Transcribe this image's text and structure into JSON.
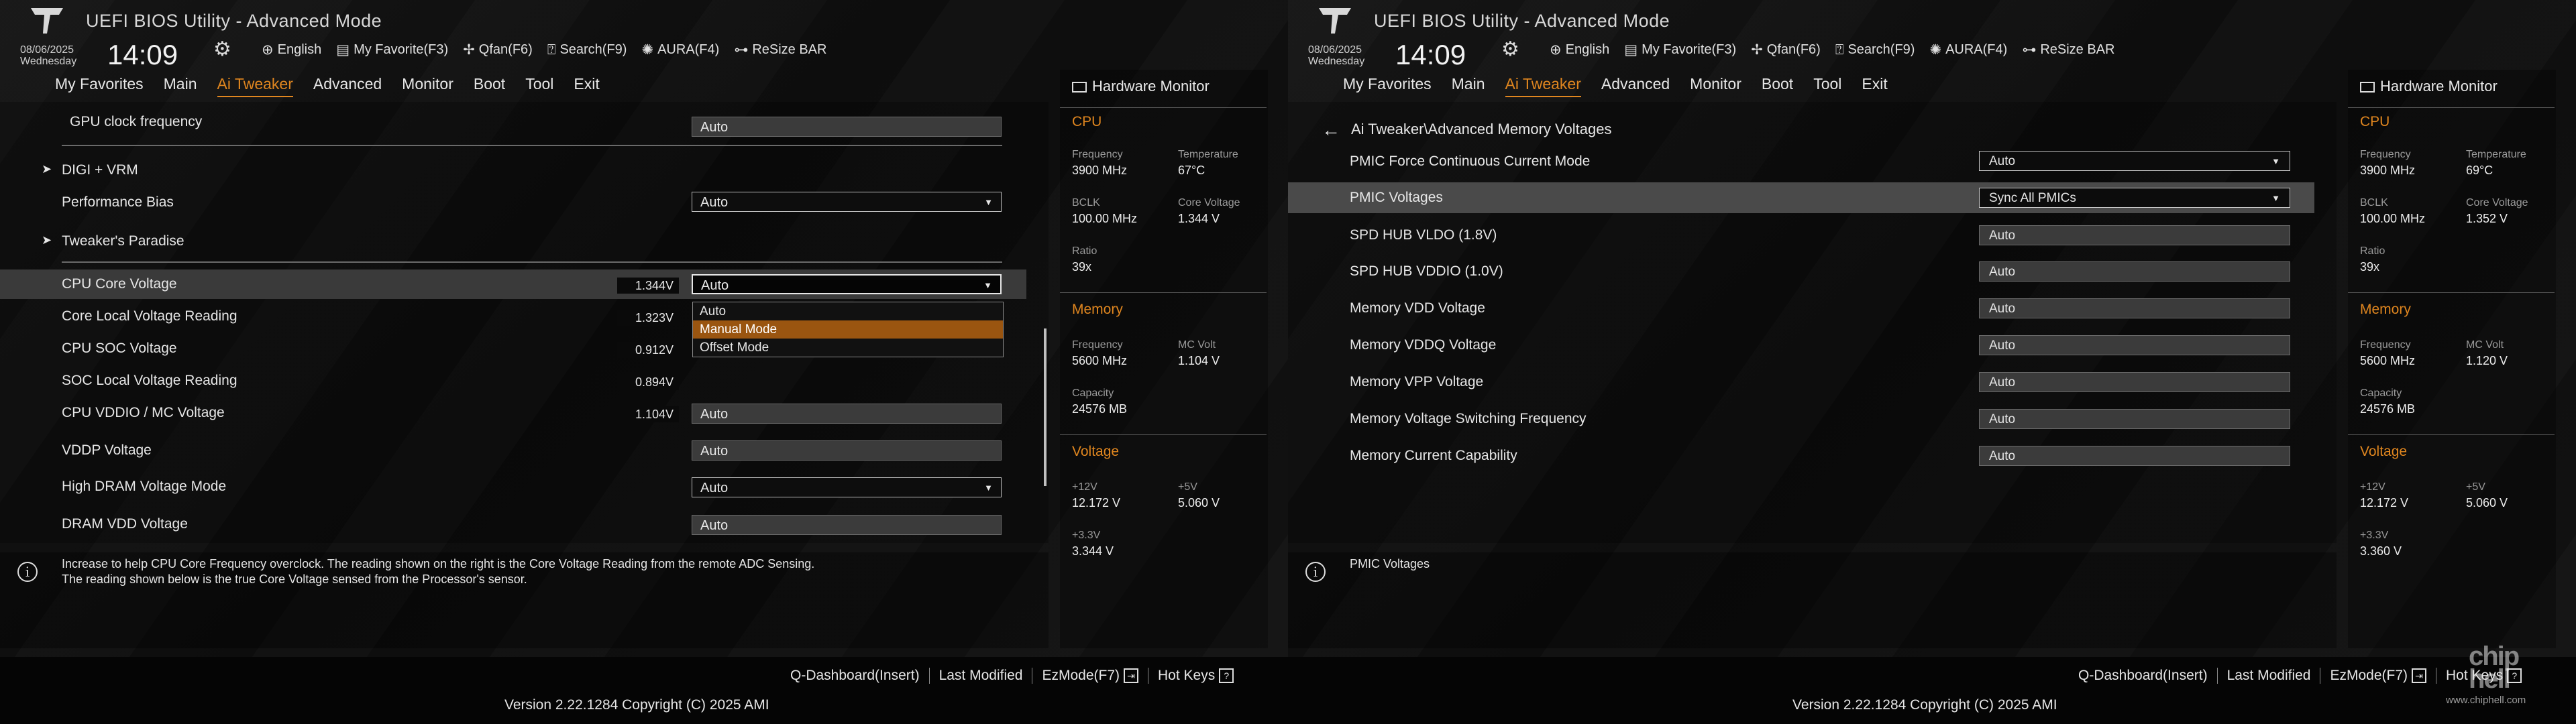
{
  "header": {
    "title": "UEFI BIOS Utility - Advanced Mode",
    "date": "08/06/2025",
    "day": "Wednesday",
    "time": "14:09",
    "toolbar": [
      {
        "icon": "globe-icon",
        "label": "English"
      },
      {
        "icon": "favorite-icon",
        "label": "My Favorite(F3)"
      },
      {
        "icon": "fan-icon",
        "label": "Qfan(F6)"
      },
      {
        "icon": "search-icon",
        "label": "Search(F9)"
      },
      {
        "icon": "aura-icon",
        "label": "AURA(F4)"
      },
      {
        "icon": "resize-bar-icon",
        "label": "ReSize BAR"
      }
    ]
  },
  "menu": [
    "My Favorites",
    "Main",
    "Ai Tweaker",
    "Advanced",
    "Monitor",
    "Boot",
    "Tool",
    "Exit"
  ],
  "left_screen": {
    "items": {
      "gpu_clock": {
        "label": "GPU clock frequency",
        "value": "Auto"
      },
      "digi_vrm": {
        "label": "DIGI + VRM"
      },
      "perf_bias": {
        "label": "Performance Bias",
        "value": "Auto"
      },
      "tweakers_paradise": {
        "label": "Tweaker's Paradise"
      },
      "cpu_core_voltage": {
        "label": "CPU Core Voltage",
        "reading": "1.344V",
        "value": "Auto"
      },
      "core_local_reading": {
        "label": "Core Local Voltage Reading",
        "reading": "1.323V"
      },
      "cpu_soc_voltage": {
        "label": "CPU SOC Voltage",
        "reading": "0.912V"
      },
      "soc_local_reading": {
        "label": "SOC Local Voltage Reading",
        "reading": "0.894V"
      },
      "cpu_vddio": {
        "label": "CPU VDDIO / MC Voltage",
        "reading": "1.104V",
        "value": "Auto"
      },
      "vddp": {
        "label": "VDDP Voltage",
        "value": "Auto"
      },
      "high_dram_mode": {
        "label": "High DRAM Voltage Mode",
        "value": "Auto"
      },
      "dram_vdd": {
        "label": "DRAM VDD Voltage",
        "value": "Auto"
      }
    },
    "dropdown_options": [
      "Auto",
      "Manual Mode",
      "Offset Mode"
    ],
    "help_line1": "Increase to help CPU Core Frequency overclock. The reading shown on the right is the Core Voltage Reading from the remote ADC Sensing.",
    "help_line2": "The reading shown below is the true Core Voltage sensed from the Processor's sensor.",
    "hw": {
      "cpu_freq": "3900 MHz",
      "cpu_temp": "67°C",
      "bclk": "100.00 MHz",
      "core_voltage": "1.344 V",
      "ratio": "39x",
      "mem_freq": "5600 MHz",
      "mc_volt": "1.104 V",
      "capacity": "24576 MB",
      "v12": "12.172 V",
      "v5": "5.060 V",
      "v33": "3.344 V"
    }
  },
  "right_screen": {
    "breadcrumb": "Ai Tweaker\\Advanced Memory Voltages",
    "items": [
      {
        "label": "PMIC Force Continuous Current Mode",
        "value": "Auto"
      },
      {
        "label": "PMIC Voltages",
        "value": "Sync All PMICs"
      },
      {
        "label": "SPD HUB VLDO (1.8V)",
        "value": "Auto"
      },
      {
        "label": "SPD HUB VDDIO (1.0V)",
        "value": "Auto"
      },
      {
        "label": "Memory VDD Voltage",
        "value": "Auto"
      },
      {
        "label": "Memory VDDQ Voltage",
        "value": "Auto"
      },
      {
        "label": "Memory VPP Voltage",
        "value": "Auto"
      },
      {
        "label": "Memory Voltage Switching Frequency",
        "value": "Auto"
      },
      {
        "label": "Memory Current Capability",
        "value": "Auto"
      }
    ],
    "help_line1": "PMIC Voltages",
    "hw": {
      "cpu_freq": "3900 MHz",
      "cpu_temp": "69°C",
      "bclk": "100.00 MHz",
      "core_voltage": "1.352 V",
      "ratio": "39x",
      "mem_freq": "5600 MHz",
      "mc_volt": "1.120 V",
      "capacity": "24576 MB",
      "v12": "12.172 V",
      "v5": "5.060 V",
      "v33": "3.360 V"
    }
  },
  "hw_labels": {
    "title": "Hardware Monitor",
    "cpu": "CPU",
    "frequency": "Frequency",
    "temperature": "Temperature",
    "bclk": "BCLK",
    "core_voltage": "Core Voltage",
    "ratio": "Ratio",
    "memory": "Memory",
    "mc_volt": "MC Volt",
    "capacity": "Capacity",
    "voltage": "Voltage",
    "v12": "+12V",
    "v5": "+5V",
    "v33": "+3.3V"
  },
  "footer": {
    "keys": [
      "Q-Dashboard(Insert)",
      "Last Modified",
      "EzMode(F7)",
      "Hot Keys"
    ],
    "copyright": "Version 2.22.1284 Copyright (C) 2025 AMI"
  },
  "watermark": {
    "logo": "chip hell",
    "url": "www.chiphell.com"
  },
  "colors": {
    "accent": "#e0861f",
    "selected_option": "#9a5510",
    "highlight_row": "#3a3a3a"
  }
}
